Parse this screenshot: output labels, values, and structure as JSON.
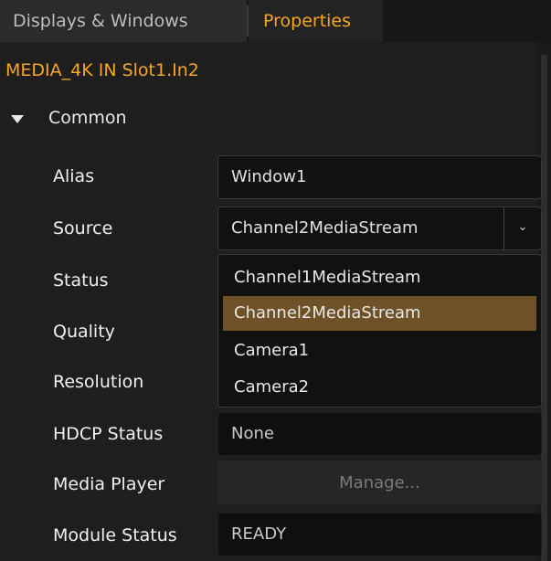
{
  "tabs": {
    "displays_label": "Displays & Windows",
    "properties_label": "Properties"
  },
  "object_title": "MEDIA_4K IN Slot1.In2",
  "section": {
    "label": "Common"
  },
  "props": {
    "alias": {
      "label": "Alias",
      "value": "Window1"
    },
    "source": {
      "label": "Source",
      "value": "Channel2MediaStream"
    },
    "status": {
      "label": "Status"
    },
    "quality": {
      "label": "Quality"
    },
    "resolution": {
      "label": "Resolution"
    },
    "hdcp": {
      "label": "HDCP Status",
      "value": "None"
    },
    "media_player": {
      "label": "Media Player",
      "button_label": "Manage..."
    },
    "module_status": {
      "label": "Module Status",
      "value": "READY"
    }
  },
  "dropdown": {
    "options": [
      "Channel1MediaStream",
      "Channel2MediaStream",
      "Camera1",
      "Camera2"
    ],
    "selected": "Channel2MediaStream"
  },
  "colors": {
    "accent": "#f5a623",
    "highlight": "#6e5126",
    "background": "#1e1e1e"
  },
  "icons": {
    "section_toggle": "caret-down-icon",
    "select_arrow": "chevron-down-icon"
  }
}
